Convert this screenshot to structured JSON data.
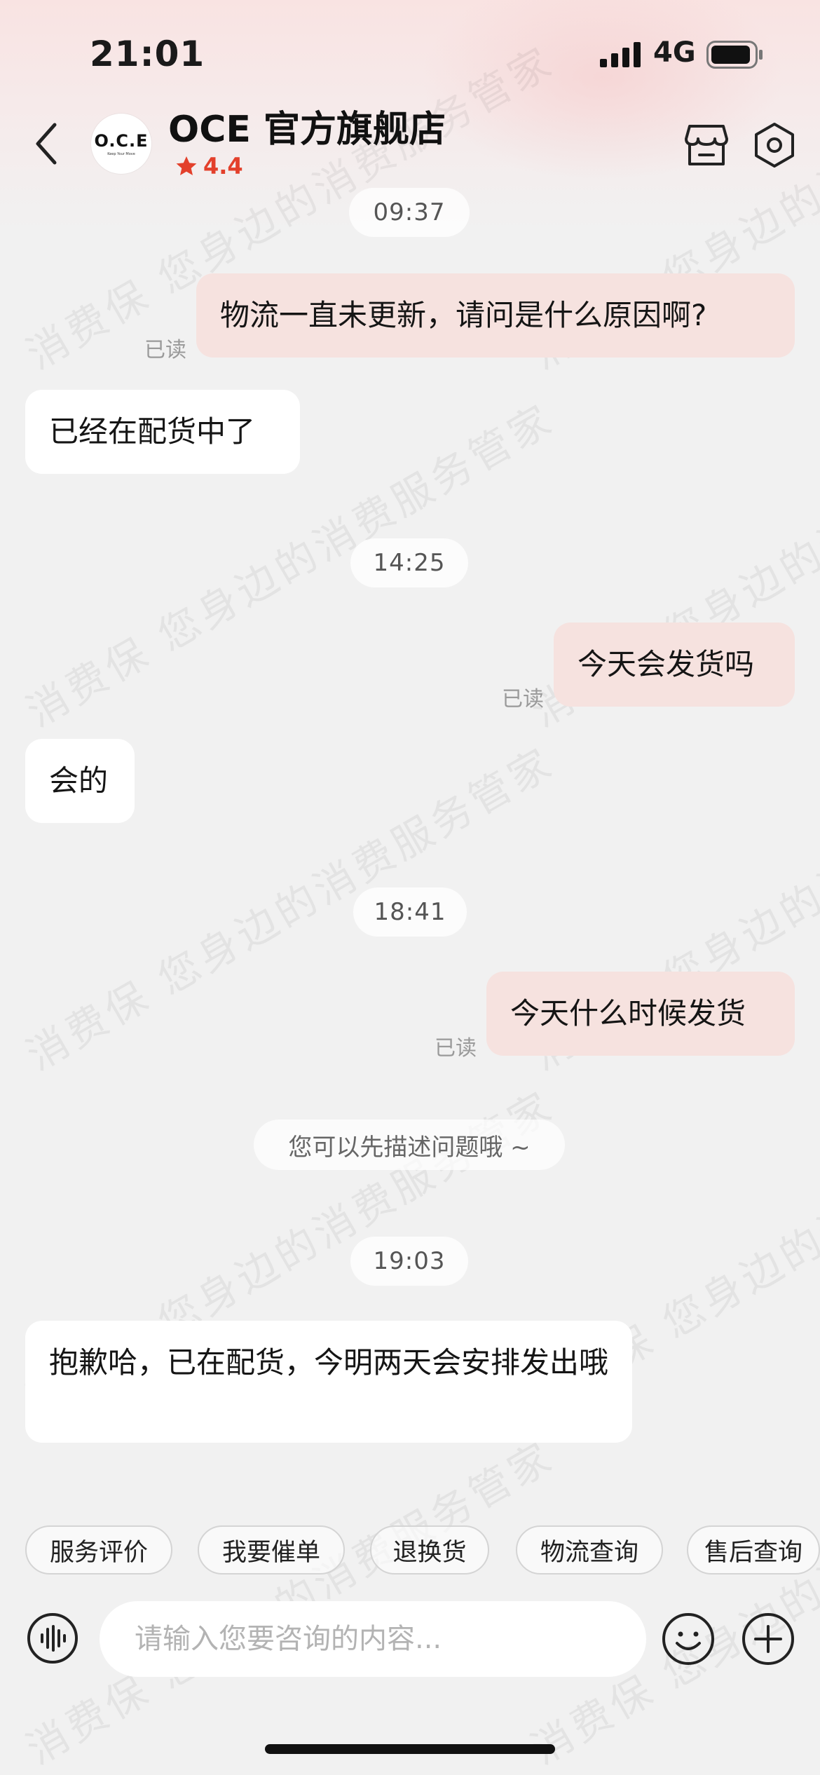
{
  "status_bar": {
    "time": "21:01",
    "network": "4G",
    "battery": "battery-icon",
    "signal": "signal-icon"
  },
  "header": {
    "back": "chevron-left-icon",
    "avatar": {
      "logo": "O.C.E",
      "logo_sub": "Keep Your Move"
    },
    "shop_name": "OCE 官方旗舰店",
    "rating": "4.4",
    "rating_icon": "star-icon",
    "store_icon": "store-icon",
    "settings_icon": "settings-hexagon-icon"
  },
  "watermark": "消费保  您身边的消费服务管家",
  "conversation": [
    {
      "type": "time",
      "text": "09:37"
    },
    {
      "type": "out",
      "text": "物流一直未更新，请问是什么原因啊?",
      "status": "已读"
    },
    {
      "type": "in",
      "text": "已经在配货中了"
    },
    {
      "type": "time",
      "text": "14:25"
    },
    {
      "type": "out",
      "text": "今天会发货吗",
      "status": "已读"
    },
    {
      "type": "in",
      "text": "会的"
    },
    {
      "type": "time",
      "text": "18:41"
    },
    {
      "type": "out",
      "text": "今天什么时候发货",
      "status": "已读"
    },
    {
      "type": "hint",
      "text": "您可以先描述问题哦 ~"
    },
    {
      "type": "time",
      "text": "19:03"
    },
    {
      "type": "in",
      "text": "抱歉哈，已在配货，今明两天会安排发出哦"
    }
  ],
  "quick_replies": [
    "服务评价",
    "我要催单",
    "退换货",
    "物流查询",
    "售后查询"
  ],
  "input": {
    "placeholder": "请输入您要咨询的内容...",
    "value": ""
  },
  "colors": {
    "accent": "#e3402b",
    "outgoing_bubble": "#f6e2df",
    "incoming_bubble": "#ffffff",
    "background": "#f1f1f1"
  }
}
